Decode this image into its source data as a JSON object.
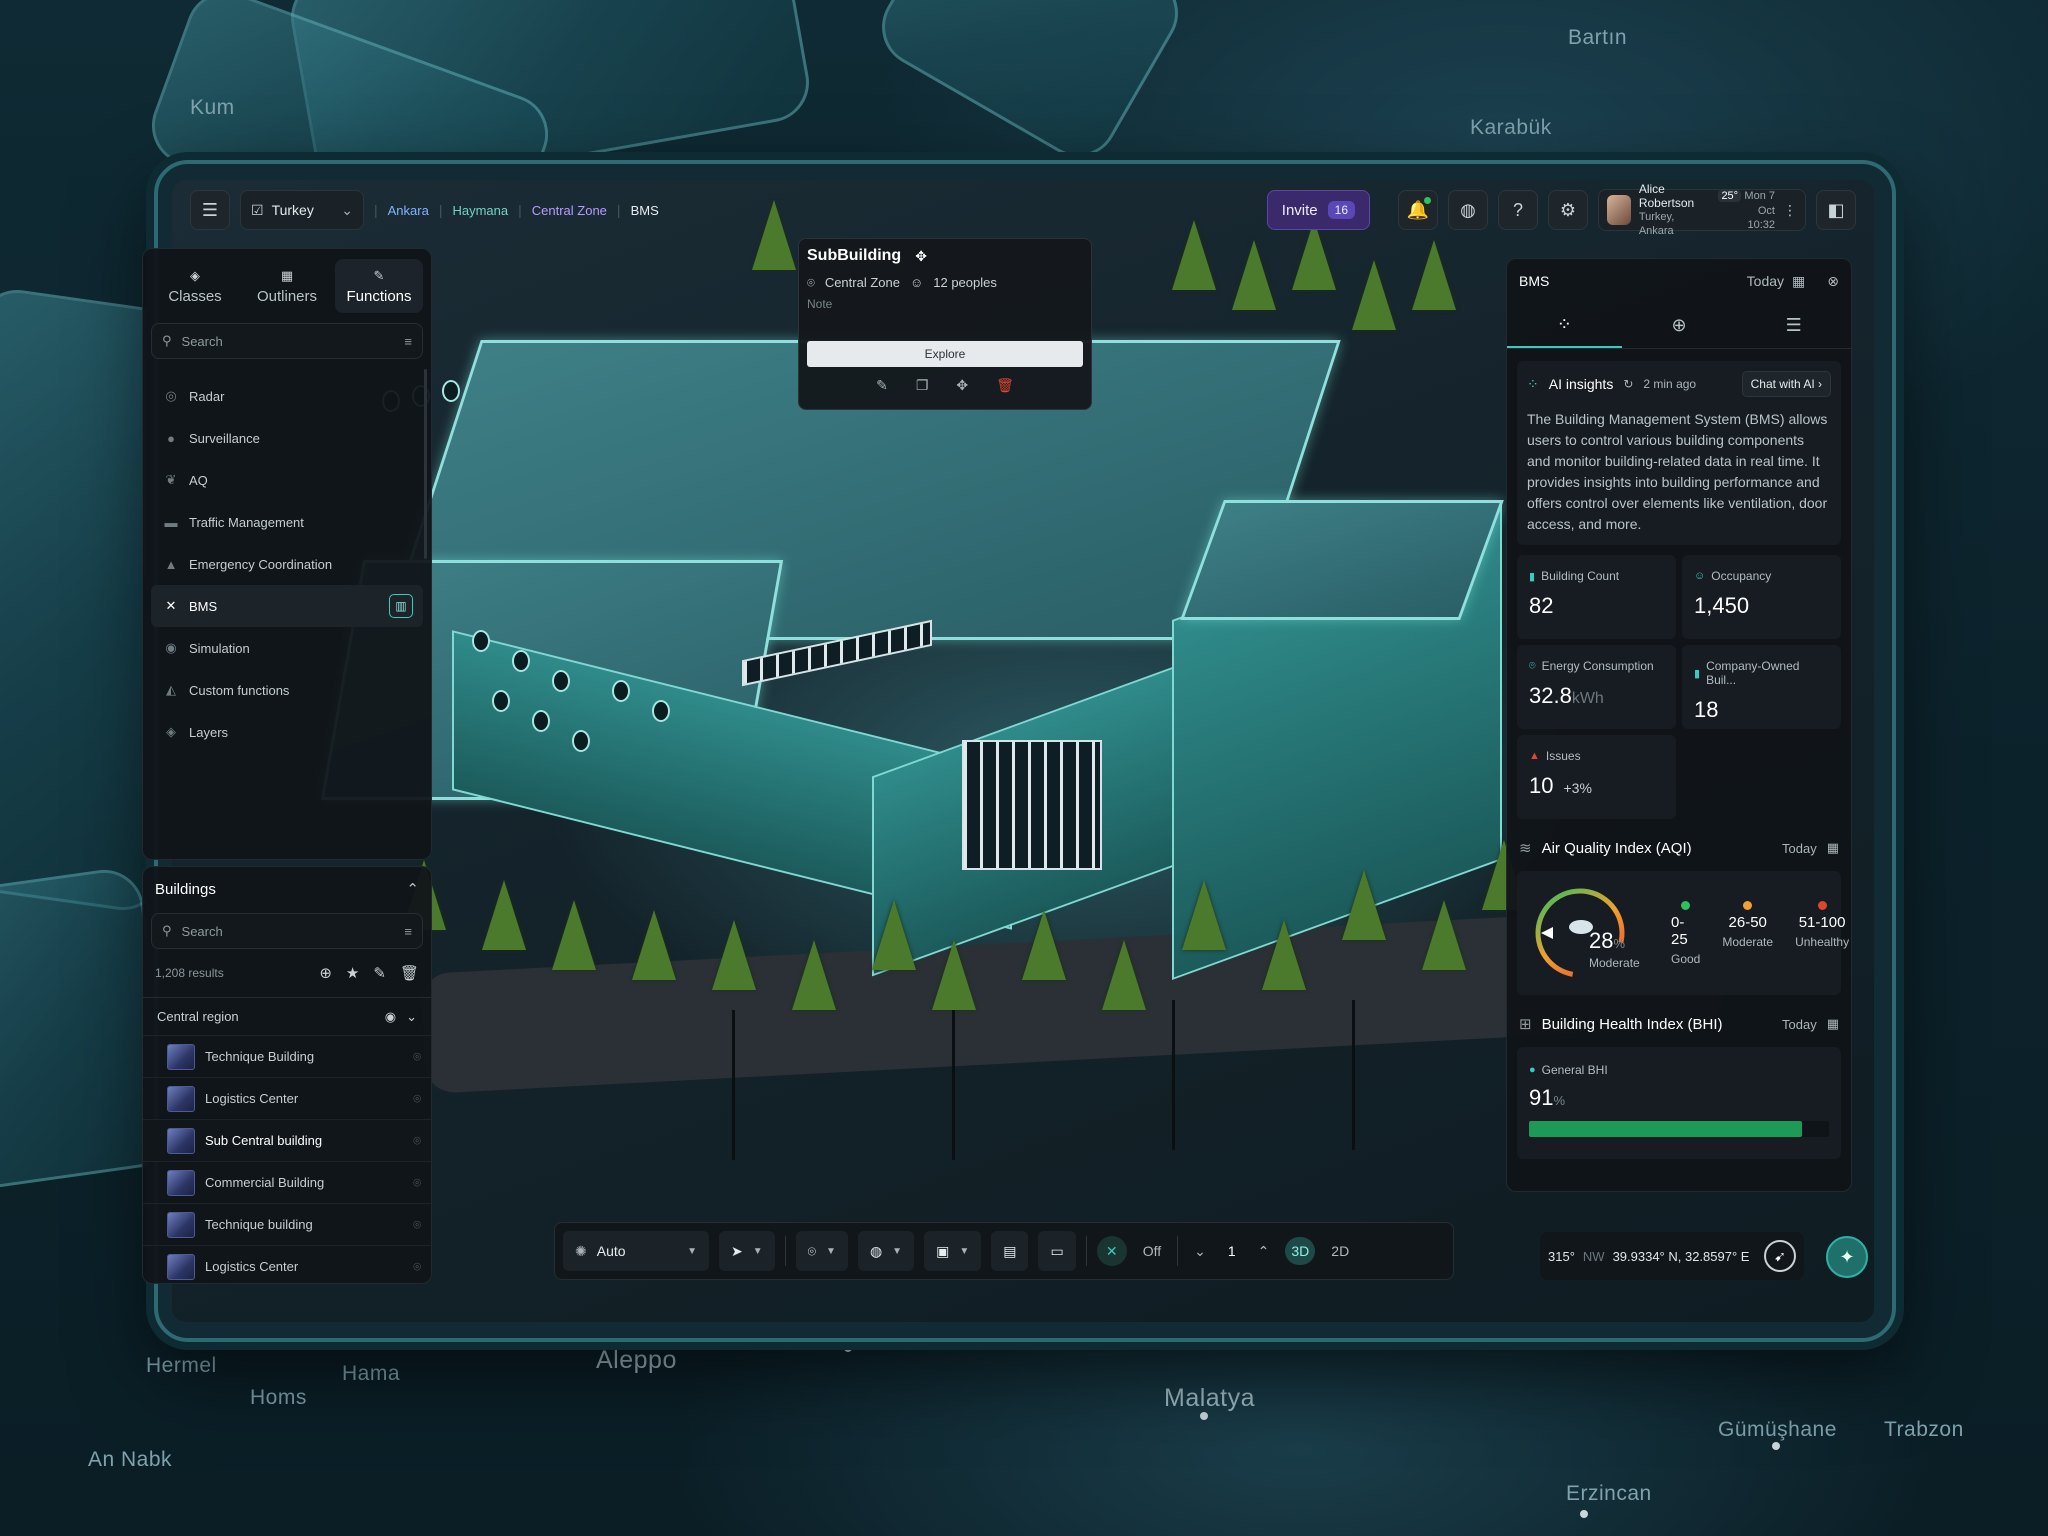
{
  "map": {
    "cities": [
      {
        "name": "Bartın",
        "big": false
      },
      {
        "name": "Karabük",
        "big": false
      },
      {
        "name": "Kum",
        "big": false
      },
      {
        "name": "Aleppo",
        "big": true
      },
      {
        "name": "Malatya",
        "big": true
      },
      {
        "name": "Hermel",
        "big": false
      },
      {
        "name": "Hama",
        "big": false
      },
      {
        "name": "Homs",
        "big": false
      },
      {
        "name": "An Nabk",
        "big": false
      },
      {
        "name": "Gümüşhane",
        "big": false
      },
      {
        "name": "Trabzon",
        "big": false
      },
      {
        "name": "Erzincan",
        "big": false
      }
    ]
  },
  "topbar": {
    "menu_icon": "menu-icon",
    "country": "Turkey",
    "breadcrumbs": [
      "Ankara",
      "Haymana",
      "Central Zone",
      "BMS"
    ],
    "invite_label": "Invite",
    "invite_count": "16",
    "user": {
      "name": "Alice Robertson",
      "city": "Turkey, Ankara",
      "date": "Mon 7 Oct",
      "time": "10:32",
      "temp": "25°"
    }
  },
  "left_panel": {
    "tabs": [
      {
        "label": "Classes",
        "icon": "layers-icon"
      },
      {
        "label": "Outliners",
        "icon": "grid-icon"
      },
      {
        "label": "Functions",
        "icon": "edit-icon"
      }
    ],
    "search_placeholder": "Search",
    "functions": [
      {
        "label": "Radar",
        "icon": "radar-icon"
      },
      {
        "label": "Surveillance",
        "icon": "camera-icon"
      },
      {
        "label": "AQ",
        "icon": "leaf-icon"
      },
      {
        "label": "Traffic Management",
        "icon": "car-icon"
      },
      {
        "label": "Emergency Coordination",
        "icon": "siren-icon"
      },
      {
        "label": "BMS",
        "icon": "close-icon",
        "active": true
      },
      {
        "label": "Simulation",
        "icon": "simulation-icon"
      },
      {
        "label": "Custom functions",
        "icon": "function-icon"
      },
      {
        "label": "Layers",
        "icon": "layers-icon"
      }
    ]
  },
  "buildings_panel": {
    "title": "Buildings",
    "search_placeholder": "Search",
    "results": "1,208 results",
    "region": "Central region",
    "items": [
      {
        "name": "Technique Building"
      },
      {
        "name": "Logistics Center"
      },
      {
        "name": "Sub Central building",
        "active": true
      },
      {
        "name": "Commercial Building"
      },
      {
        "name": "Technique building"
      },
      {
        "name": "Logistics Center"
      }
    ]
  },
  "popup": {
    "title": "SubBuilding",
    "zone": "Central Zone",
    "people": "12 peoples",
    "note": "Note",
    "explore": "Explore"
  },
  "right_panel": {
    "title": "BMS",
    "date_filter": "Today",
    "ai": {
      "title": "AI insights",
      "updated": "2 min ago",
      "chat_label": "Chat with AI",
      "text": "The Building Management System (BMS) allows users to control various building components and monitor building-related data in real time. It provides insights into building performance and offers control over elements like ventilation, door access, and more."
    },
    "kpis": [
      {
        "label": "Building Count",
        "value": "82",
        "unit": ""
      },
      {
        "label": "Occupancy",
        "value": "1,450",
        "unit": ""
      },
      {
        "label": "Energy Consumption",
        "value": "32.8",
        "unit": "kWh"
      },
      {
        "label": "Company-Owned Buil...",
        "value": "18",
        "unit": ""
      },
      {
        "label": "Issues",
        "value": "10",
        "unit": "",
        "delta": "+3%"
      }
    ],
    "aqi": {
      "title": "Air Quality Index (AQI)",
      "date_filter": "Today",
      "value": "28",
      "unit": "%",
      "level": "Moderate",
      "legend": [
        {
          "range": "0-25",
          "label": "Good",
          "color": "#2fbf5f"
        },
        {
          "range": "26-50",
          "label": "Moderate",
          "color": "#f0a030"
        },
        {
          "range": "51-100",
          "label": "Unhealthy",
          "color": "#e0452f"
        }
      ]
    },
    "bhi": {
      "title": "Building Health Index (BHI)",
      "date_filter": "Today",
      "label": "General BHI",
      "value": "91",
      "unit": "%",
      "fraction": 0.91,
      "color": "#1d9a55"
    }
  },
  "toolbar": {
    "mode": "Auto",
    "off": "Off",
    "level": "1",
    "view3d": "3D",
    "view2d": "2D"
  },
  "coords": {
    "heading": "315°",
    "dir": "NW",
    "latlon": "39.9334° N, 32.8597° E"
  }
}
